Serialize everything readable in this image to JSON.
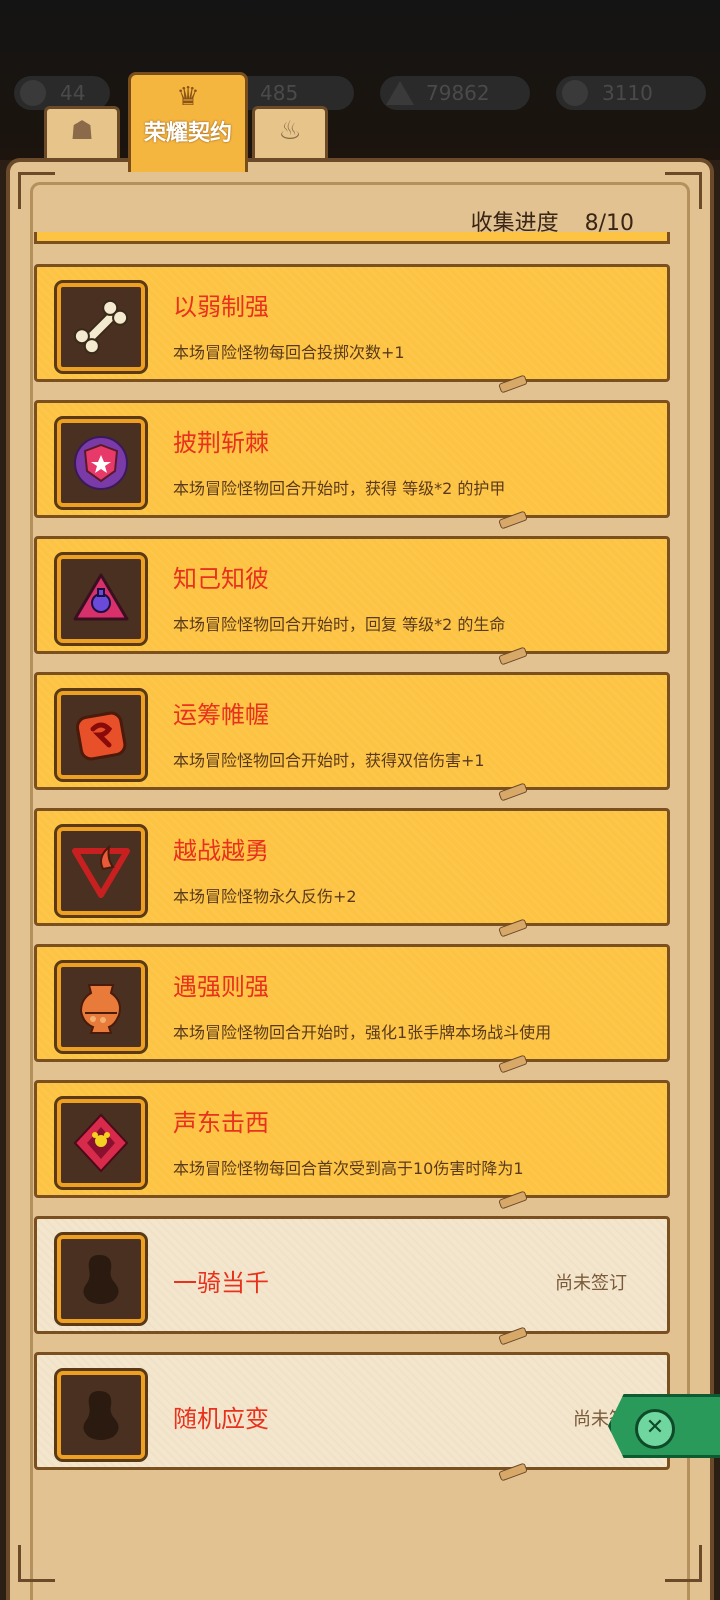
{
  "resources": [
    {
      "name": "gem",
      "value": "44"
    },
    {
      "name": "coin",
      "value": "485"
    },
    {
      "name": "crystal",
      "value": "79862"
    },
    {
      "name": "leaf",
      "value": "3110"
    }
  ],
  "tabs": [
    {
      "icon": "bone-tab-icon",
      "label": ""
    },
    {
      "icon": "crown-icon",
      "label": "荣耀契约",
      "active": true
    },
    {
      "icon": "flame-tab-icon",
      "label": ""
    }
  ],
  "header": {
    "progress_label": "收集进度",
    "progress_value": "8/10"
  },
  "contracts": [
    {
      "name": "以弱制强",
      "desc": "本场冒险怪物每回合投掷次数+1",
      "icon": "bone-icon",
      "locked": false
    },
    {
      "name": "披荆斩棘",
      "desc": "本场冒险怪物回合开始时，获得 等级*2 的护甲",
      "icon": "star-shield-icon",
      "locked": false
    },
    {
      "name": "知己知彼",
      "desc": "本场冒险怪物回合开始时，回复 等级*2 的生命",
      "icon": "potion-icon",
      "locked": false
    },
    {
      "name": "运筹帷幄",
      "desc": "本场冒险怪物回合开始时，获得双倍伤害+1",
      "icon": "rune-stone-icon",
      "locked": false
    },
    {
      "name": "越战越勇",
      "desc": "本场冒险怪物永久反伤+2",
      "icon": "horn-triangle-icon",
      "locked": false
    },
    {
      "name": "遇强则强",
      "desc": "本场冒险怪物回合开始时，强化1张手牌本场战斗使用",
      "icon": "vase-icon",
      "locked": false
    },
    {
      "name": "声东击西",
      "desc": "本场冒险怪物每回合首次受到高于10伤害时降为1",
      "icon": "demon-emblem-icon",
      "locked": false
    },
    {
      "name": "一骑当千",
      "desc": "",
      "status": "尚未签订",
      "icon": "locked-silhouette-icon",
      "locked": true
    },
    {
      "name": "随机应变",
      "desc": "",
      "status": "尚未签",
      "icon": "locked-silhouette-icon",
      "locked": true
    }
  ],
  "close_button": {
    "icon": "close-icon",
    "symbol": "✕"
  },
  "colors": {
    "card_active": "#fdc342",
    "card_locked": "#f4e6cc",
    "title_red": "#e8321e",
    "panel": "#e3c292"
  }
}
